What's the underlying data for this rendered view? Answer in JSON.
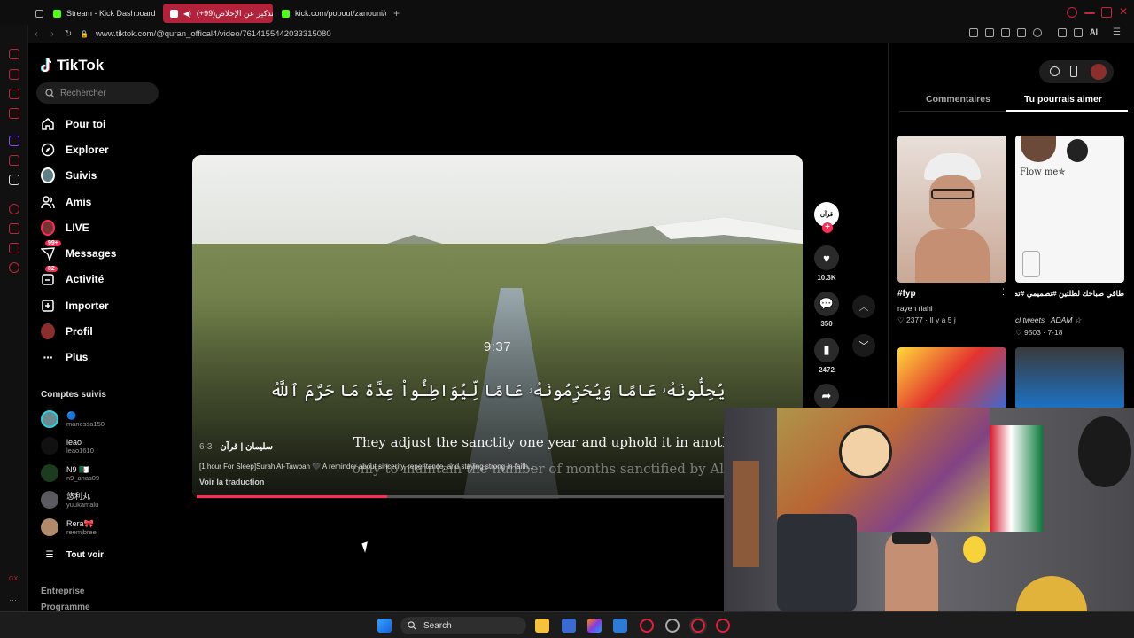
{
  "browser": {
    "tabs": [
      {
        "label": "Stream - Kick Dashboard",
        "favicon_color": "#53fc18"
      },
      {
        "label": "(+99)تذكير عن الإخلاص ♪",
        "favicon_color": "#ffffff"
      },
      {
        "label": "kick.com/popout/zanouni/c",
        "favicon_color": "#53fc18"
      }
    ],
    "new_tab": "+",
    "url": "www.tiktok.com/@quran_offical4/video/7614155442033315080",
    "ai_label": "AI"
  },
  "sidebar": {
    "logo": "TikTok",
    "search_placeholder": "Rechercher",
    "nav": [
      {
        "label": "Pour toi",
        "icon": "home-icon"
      },
      {
        "label": "Explorer",
        "icon": "compass-icon"
      },
      {
        "label": "Suivis",
        "icon": "following-avatar-icon"
      },
      {
        "label": "Amis",
        "icon": "friends-icon"
      },
      {
        "label": "LIVE",
        "icon": "live-icon"
      },
      {
        "label": "Messages",
        "icon": "messages-icon",
        "badge": "99+"
      },
      {
        "label": "Activité",
        "icon": "activity-icon",
        "badge": "82"
      },
      {
        "label": "Importer",
        "icon": "upload-icon"
      },
      {
        "label": "Profil",
        "icon": "profile-avatar-icon"
      },
      {
        "label": "Plus",
        "icon": "more-icon"
      }
    ],
    "following_title": "Comptes suivis",
    "following": [
      {
        "name": "🔵",
        "handle": "manessa150"
      },
      {
        "name": "leao",
        "handle": "leao1610"
      },
      {
        "name": "N9 🇩🇿",
        "handle": "n9_anas09"
      },
      {
        "name": "悠利丸",
        "handle": "yuukamalu"
      },
      {
        "name": "Rera🎀",
        "handle": "reemjbreel"
      }
    ],
    "see_all": "Tout voir",
    "footer": [
      "Entreprise",
      "Programme"
    ]
  },
  "video": {
    "timestamp": "9:37",
    "arabic_verse": "يُحِلُّونَهُۥ عَامًا وَيُحَرِّمُونَهُۥ عَامًا لِّيُوَاطِـُٔواْ عِدَّةَ مَا حَرَّمَ ٱللَّهُ",
    "english_line1": "They adjust the sanctity one year and uphold it in another,",
    "english_line2": "only to maintain the number of months sanctified by Allah,",
    "author": "سليمان | قرآن",
    "date": " · 3-6",
    "description": "[1 hour For Sleep]Surah At-Tawbah 🖤 A reminder about sincerity, repentance, and staying strong in faith...",
    "translate_label": "Voir la traduction",
    "progress": 0.36
  },
  "actions": {
    "creator_label": "قرآن",
    "likes": "10.3K",
    "comments": "350",
    "saves": "2472"
  },
  "right_panel": {
    "tabs": [
      "Commentaires",
      "Tu pourrais aimer"
    ],
    "active_tab": 1,
    "cards": [
      {
        "title": "#fyp",
        "author": "rayen riahi",
        "stats": "♡ 2377 · Il y a 5 j"
      },
      {
        "title": "طاقي صباحك لطلتين #تصميمي #تصميم فيديوهات 🎬",
        "overlay": "Flow me✯",
        "author": "cl tweets_ ADAM ☆",
        "stats": "♡ 9503 · 7-18"
      }
    ]
  },
  "taskbar": {
    "search_placeholder": "Search"
  }
}
